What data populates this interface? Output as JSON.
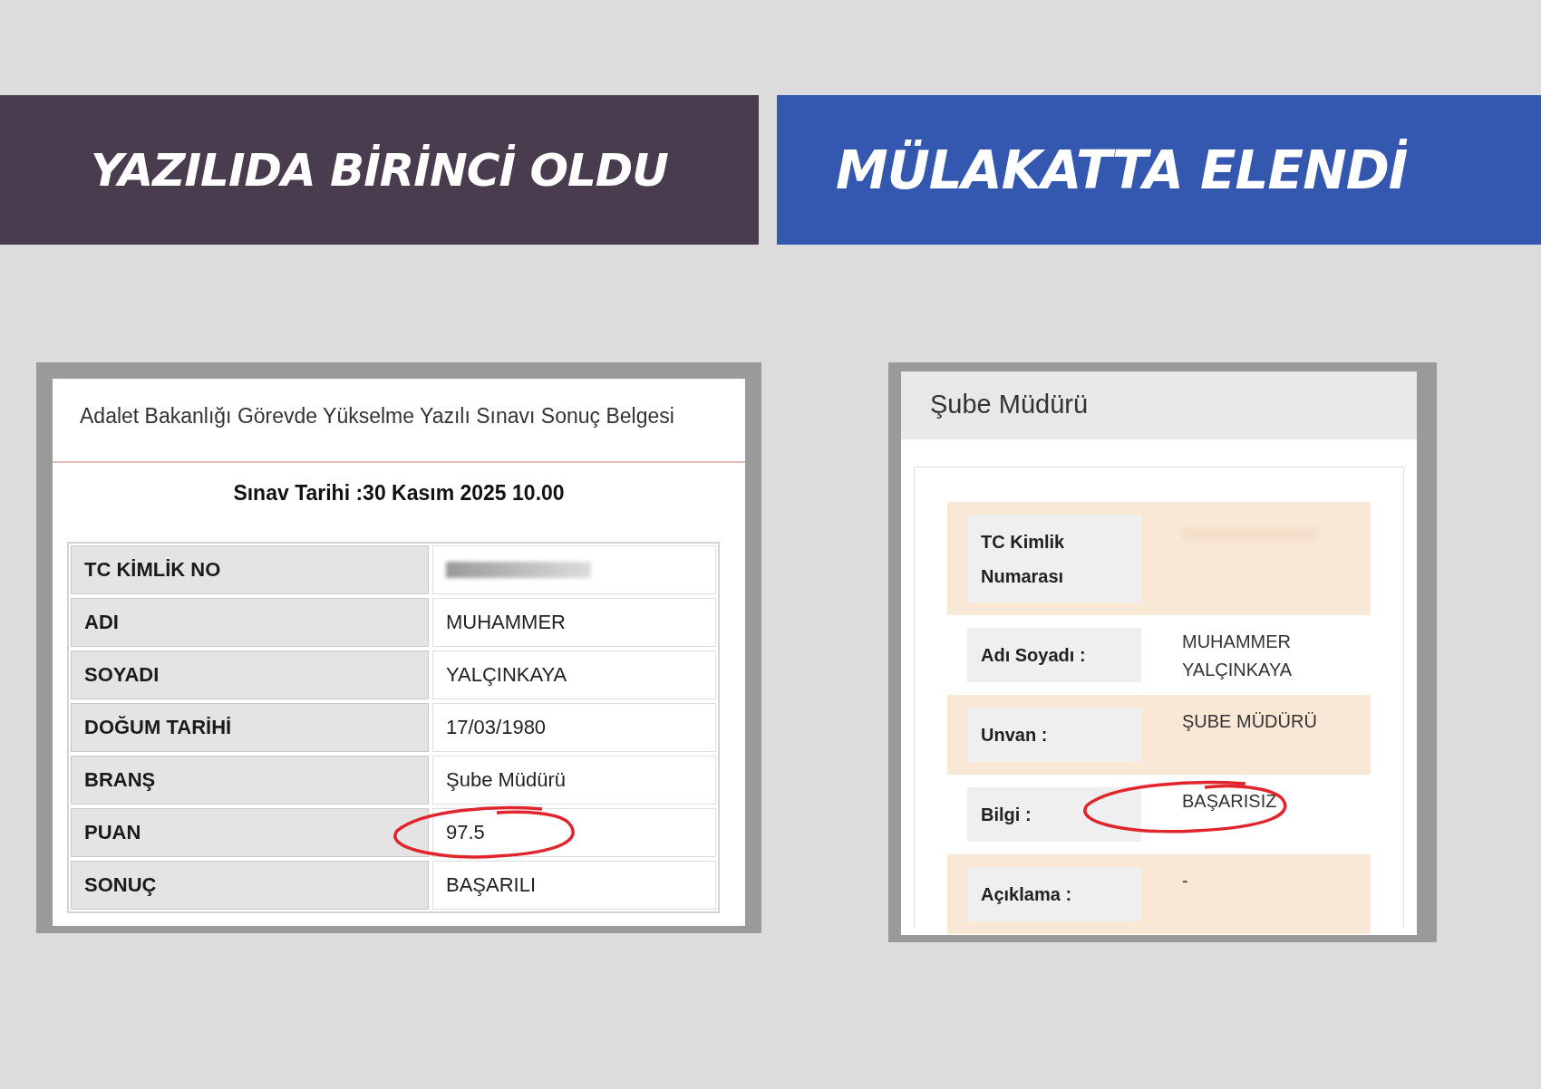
{
  "banners": [
    {
      "text": "YAZILIDA BİRİNCİ OLDU",
      "color": "#4a3c4f"
    },
    {
      "text": "MÜLAKATTA ELENDİ",
      "color": "#3457b0"
    }
  ],
  "exam_result": {
    "title": "Adalet Bakanlığı Görevde Yükselme Yazılı Sınavı Sonuç Belgesi",
    "date": "Sınav Tarihi :30 Kasım 2025 10.00",
    "rows": [
      {
        "label": "TC KİMLİK NO",
        "redacted": true,
        "circled": false
      },
      {
        "label": "ADI",
        "value": "MUHAMMER",
        "redacted": false,
        "circled": false
      },
      {
        "label": "SOYADI",
        "value": "YALÇINKAYA",
        "redacted": false,
        "circled": false
      },
      {
        "label": "DOĞUM TARİHİ",
        "value": "17/03/1980",
        "redacted": false,
        "circled": false
      },
      {
        "label": "BRANŞ",
        "value": "Şube Müdürü",
        "redacted": false,
        "circled": false
      },
      {
        "label": "PUAN",
        "value": "97.5",
        "redacted": false,
        "circled": true
      },
      {
        "label": "SONUÇ",
        "value": "BAŞARILI",
        "redacted": false,
        "circled": false
      }
    ]
  },
  "interview_result": {
    "title": "Şube Müdürü",
    "rows": [
      {
        "label": "TC Kimlik Numarası",
        "lines": [],
        "highlighted": true,
        "redacted": true,
        "circled": false
      },
      {
        "label": "Adı Soyadı :",
        "lines": [
          "MUHAMMER",
          "YALÇINKAYA"
        ],
        "highlighted": false,
        "redacted": false,
        "circled": false
      },
      {
        "label": "Unvan :",
        "lines": [
          "ŞUBE MÜDÜRÜ"
        ],
        "highlighted": true,
        "redacted": false,
        "circled": false
      },
      {
        "label": "Bilgi :",
        "lines": [
          "BAŞARISIZ"
        ],
        "highlighted": false,
        "redacted": false,
        "circled": true
      },
      {
        "label": "Açıklama :",
        "lines": [
          "-"
        ],
        "highlighted": true,
        "redacted": false,
        "circled": false
      }
    ]
  }
}
